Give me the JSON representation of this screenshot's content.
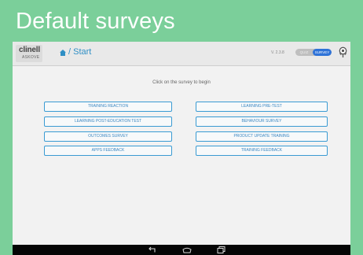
{
  "banner": {
    "title": "Default surveys"
  },
  "header": {
    "logo_main": "clinell",
    "logo_sub": "ASKOVE",
    "home_icon": "home-icon",
    "breadcrumb": "/ Start",
    "version": "V. 2.3.8",
    "mode_off_label": "QUIZ",
    "mode_on_label": "SURVEY",
    "selected_mode": "SURVEY",
    "settings_icon": "pin-icon"
  },
  "main": {
    "prompt": "Click on the survey to begin",
    "surveys": [
      "TRAINING REACTION",
      "LEARNING PRE-TEST",
      "LEARNING POST-EDUCATION TEST",
      "BEHAVIOUR SURVEY",
      "OUTCOMES SURVEY",
      "PRODUCT UPDATE TRAINING",
      "APPS FEEDBACK",
      "TRAINING FEEDBACK"
    ]
  },
  "nav": {
    "back_icon": "back-icon",
    "home_icon": "home-outline-icon",
    "recent_icon": "recent-apps-icon"
  },
  "colors": {
    "banner": "#7bcf9a",
    "accent": "#3a9bd3",
    "toggle_active": "#2f73d8",
    "nav_bar": "#050505"
  }
}
